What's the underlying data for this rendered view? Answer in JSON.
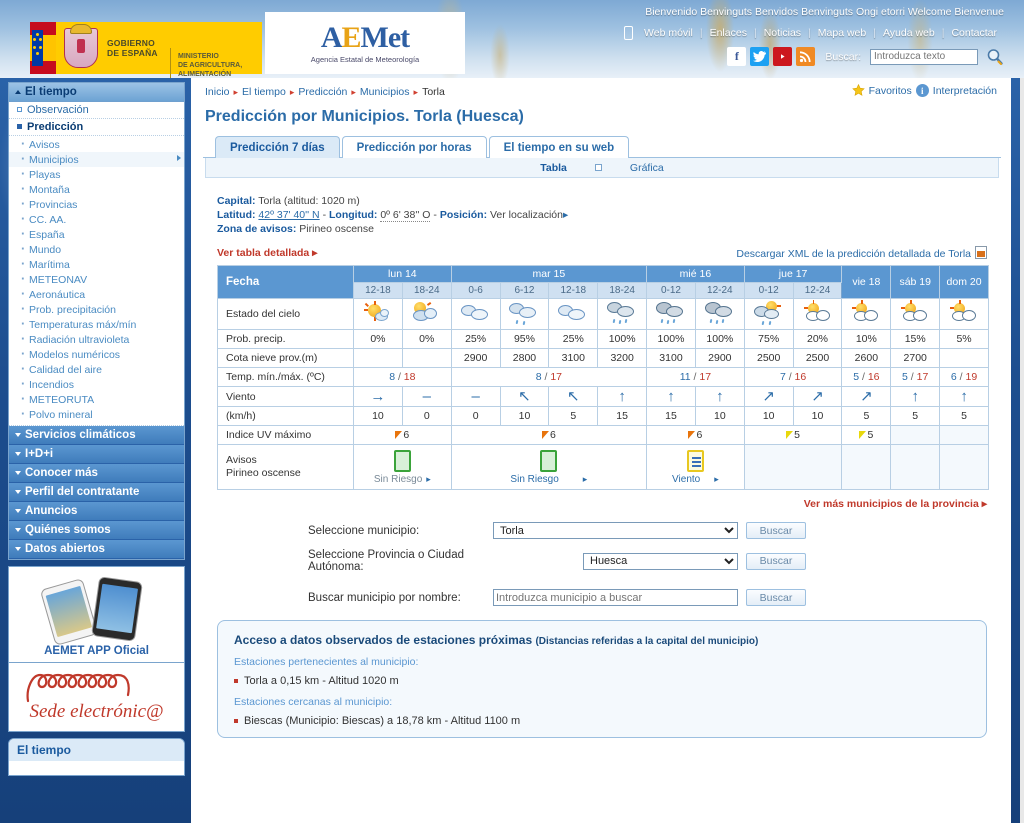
{
  "header": {
    "gobierno_line1": "GOBIERNO",
    "gobierno_line2": "DE ESPAÑA",
    "ministerio": "MINISTERIO\nDE AGRICULTURA, ALIMENTACIÓN\nY MEDIO AMBIENTE",
    "aemet_a": "A",
    "aemet_e": "E",
    "aemet_met": "Met",
    "aemet_sub": "Agencia Estatal de Meteorología",
    "welcome": "Bienvenido Benvinguts Benvidos Benvinguts Ongi etorri Welcome Bienvenue",
    "nav": [
      "Web móvil",
      "Enlaces",
      "Noticias",
      "Mapa web",
      "Ayuda web",
      "Contactar"
    ],
    "social": [
      "facebook-icon",
      "twitter-icon",
      "youtube-icon",
      "rss-icon"
    ],
    "search_label": "Buscar:",
    "search_placeholder": "Introduzca texto",
    "search_value": ""
  },
  "sidebar": {
    "eltiempo_head": "El tiempo",
    "observacion": "Observación",
    "prediccion": "Predicción",
    "sub_items": [
      "Avisos",
      "Municipios",
      "Playas",
      "Montaña",
      "Provincias",
      "CC. AA.",
      "España",
      "Mundo",
      "Marítima",
      "METEONAV",
      "Aeronáutica",
      "Prob. precipitación",
      "Temperaturas máx/mín",
      "Radiación ultravioleta",
      "Modelos numéricos",
      "Calidad del aire",
      "Incendios",
      "METEORUTA",
      "Polvo mineral"
    ],
    "selected_sub": "Municipios",
    "sections": [
      "Servicios climáticos",
      "I+D+i",
      "Conocer más",
      "Perfil del contratante",
      "Anuncios",
      "Quiénes somos",
      "Datos abiertos"
    ],
    "app_promo": "AEMET APP Oficial",
    "sede": "Sede electrónic@",
    "bottom_box_head": "El tiempo"
  },
  "content": {
    "breadcrumb": [
      "Inicio",
      "El tiempo",
      "Predicción",
      "Municipios",
      "Torla"
    ],
    "favoritos": "Favoritos",
    "interpretacion": "Interpretación",
    "title": "Predicción por Municipios. Torla (Huesca)",
    "tabs": [
      {
        "label": "Predicción 7 días",
        "active": true
      },
      {
        "label": "Predicción por horas",
        "active": false
      },
      {
        "label": "El tiempo en su web",
        "active": false
      }
    ],
    "view_tabla": "Tabla",
    "view_grafica": "Gráfica",
    "capital_label": "Capital:",
    "capital_value": "Torla (altitud: 1020 m)",
    "latitud_label": "Latitud:",
    "latitud_value": "42º 37' 40'' N",
    "longitud_label": "Longitud:",
    "longitud_value": "0º 6' 38'' O",
    "posicion_label": "Posición:",
    "posicion_value": "Ver localización",
    "zona_label": "Zona de avisos:",
    "zona_value": "Pirineo oscense",
    "ver_tabla": "Ver tabla detallada",
    "xml_link": "Descargar XML de la predicción detallada de Torla",
    "ver_mas_municipios": "Ver más municipios de la provincia"
  },
  "chart_data": {
    "type": "table",
    "title": "Predicción por Municipios. Torla (Huesca)",
    "row_labels": {
      "fecha": "Fecha",
      "estado_cielo": "Estado del cielo",
      "prob_precip": "Prob. precip.",
      "cota_nieve": "Cota nieve prov.(m)",
      "temp": "Temp. mín./máx. (ºC)",
      "viento": "Viento",
      "viento_unit": "(km/h)",
      "uv": "Indice UV máximo",
      "avisos": "Avisos",
      "avisos_zona": "Pirineo oscense"
    },
    "days": [
      {
        "name": "lun 14",
        "slots": [
          "12-18",
          "18-24"
        ]
      },
      {
        "name": "mar 15",
        "slots": [
          "0-6",
          "6-12",
          "12-18",
          "18-24"
        ]
      },
      {
        "name": "mié 16",
        "slots": [
          "0-12",
          "12-24"
        ]
      },
      {
        "name": "jue 17",
        "slots": [
          "0-12",
          "12-24"
        ]
      },
      {
        "name": "vie 18",
        "slots": []
      },
      {
        "name": "sáb 19",
        "slots": []
      },
      {
        "name": "dom 20",
        "slots": []
      }
    ],
    "sky": [
      "sun-small-cloud",
      "sun-behind-cloud",
      "cloudy",
      "cloudy-light-rain",
      "cloudy",
      "cloudy-rain",
      "cloudy-rain",
      "cloudy-rain",
      "sun-cloud-rain",
      "sun-cloud",
      "sun-cloud",
      "sun-cloud",
      "sun-cloud"
    ],
    "prob_precip": [
      "0%",
      "0%",
      "25%",
      "95%",
      "25%",
      "100%",
      "100%",
      "100%",
      "75%",
      "20%",
      "10%",
      "15%",
      "5%"
    ],
    "cota_nieve": [
      "",
      "",
      "2900",
      "2800",
      "3100",
      "3200",
      "3100",
      "2900",
      "2500",
      "2500",
      "2600",
      "2700",
      ""
    ],
    "temps": [
      {
        "day": "lun 14",
        "min": "8",
        "max": "18",
        "span": 2
      },
      {
        "day": "mar 15",
        "min": "8",
        "max": "17",
        "span": 4
      },
      {
        "day": "mié 16",
        "min": "11",
        "max": "17",
        "span": 2
      },
      {
        "day": "jue 17",
        "min": "7",
        "max": "16",
        "span": 2
      },
      {
        "day": "vie 18",
        "min": "5",
        "max": "16",
        "span": 1
      },
      {
        "day": "sáb 19",
        "min": "5",
        "max": "17",
        "span": 1
      },
      {
        "day": "dom 20",
        "min": "6",
        "max": "19",
        "span": 1
      }
    ],
    "wind_dir": [
      "→",
      "–",
      "–",
      "↖",
      "↖",
      "↑",
      "↑",
      "↑",
      "↗",
      "↗",
      "↗",
      "↑",
      "↑"
    ],
    "wind_speed": [
      "10",
      "0",
      "0",
      "10",
      "5",
      "15",
      "15",
      "10",
      "10",
      "10",
      "5",
      "5",
      "5"
    ],
    "uv": [
      {
        "span": 2,
        "value": "6",
        "level": "orange"
      },
      {
        "span": 4,
        "value": "6",
        "level": "orange"
      },
      {
        "span": 2,
        "value": "6",
        "level": "orange"
      },
      {
        "span": 2,
        "value": "5",
        "level": "yellow"
      },
      {
        "span": 1,
        "value": "5",
        "level": "yellow"
      },
      {
        "span": 1,
        "value": "",
        "level": "none"
      },
      {
        "span": 1,
        "value": "",
        "level": "none"
      }
    ],
    "avisos": [
      {
        "span": 2,
        "label": "Sin Riesgo",
        "level": "green"
      },
      {
        "span": 4,
        "label": "Sin Riesgo",
        "level": "green"
      },
      {
        "span": 2,
        "label": "Viento",
        "level": "yellow"
      },
      {
        "span": 2,
        "label": "",
        "level": "none"
      },
      {
        "span": 1,
        "label": "",
        "level": "none"
      },
      {
        "span": 1,
        "label": "",
        "level": "none"
      },
      {
        "span": 1,
        "label": "",
        "level": "none"
      }
    ]
  },
  "forms": {
    "municipio_label": "Seleccione municipio:",
    "municipio_value": "Torla",
    "provincia_label": "Seleccione Provincia o Ciudad Autónoma:",
    "provincia_value": "Huesca",
    "nombre_label": "Buscar municipio por nombre:",
    "nombre_placeholder": "Introduzca municipio a buscar",
    "nombre_value": "",
    "buscar_btn": "Buscar"
  },
  "stations": {
    "title": "Acceso a datos observados de estaciones próximas",
    "title_small": "(Distancias referidas a la capital del municipio)",
    "sub1": "Estaciones pertenecientes al municipio:",
    "item1": "Torla a 0,15 km - Altitud 1020 m",
    "sub2": "Estaciones cercanas al municipio:",
    "item2": "Biescas (Municipio:  Biescas) a 18,78 km - Altitud 1100 m"
  },
  "colors": {
    "brand_blue": "#2b6ca8",
    "header_blue": "#5b97d1",
    "temp_min": "#2b6ca8",
    "temp_max": "#c0392b",
    "accent_red": "#c0392b",
    "gov_yellow": "#ffcc00"
  }
}
